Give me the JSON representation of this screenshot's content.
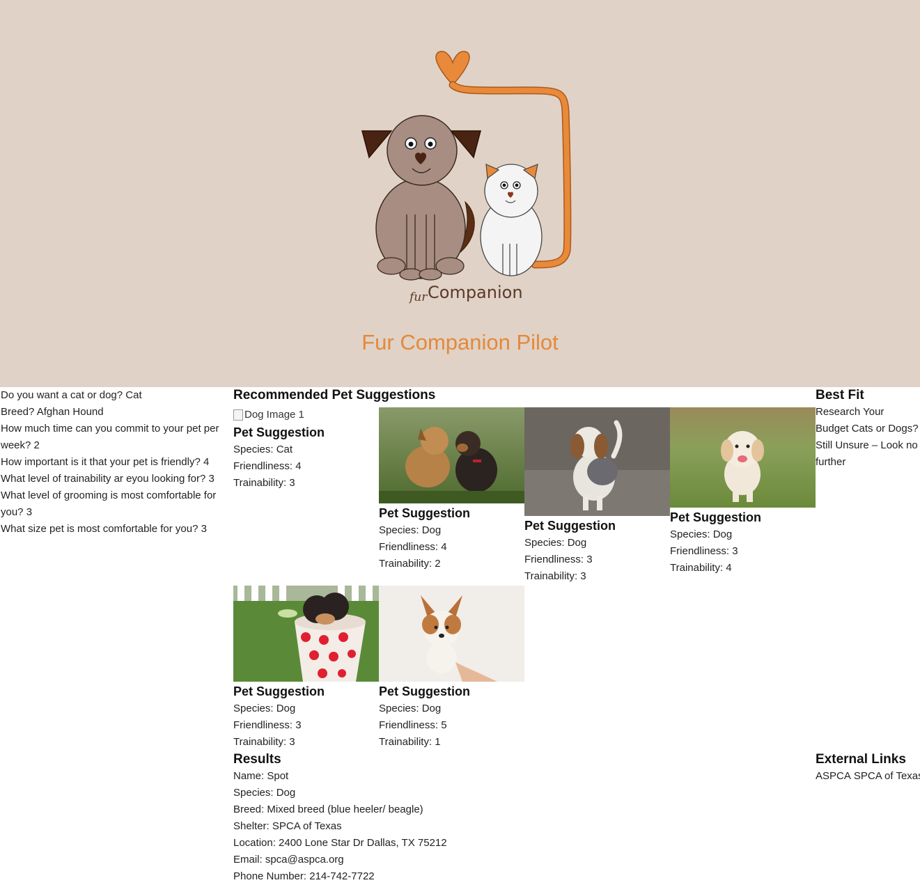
{
  "header": {
    "logo_text_small": "fur",
    "logo_text": "Companion",
    "title": "Fur Companion Pilot"
  },
  "questions": [
    {
      "text": "Do you want a cat or dog? Cat"
    },
    {
      "text": "Breed? Afghan Hound"
    },
    {
      "text": "How much time can you commit to your pet per week? 2"
    },
    {
      "text": "How important is it that your pet is friendly? 4"
    },
    {
      "text": "What level of trainability ar eyou looking for? 3"
    },
    {
      "text": "What level of grooming is most comfortable for you? 3"
    },
    {
      "text": "What size pet is most comfortable for you? 3"
    }
  ],
  "recommended": {
    "heading": "Recommended Pet Suggestions",
    "cards": [
      {
        "title": "Pet Suggestion",
        "alt": "Dog Image 1",
        "species": "Species: Cat",
        "friendliness": "Friendliness: 4",
        "trainability": "Trainability: 3"
      },
      {
        "title": "Pet Suggestion",
        "species": "Species: Dog",
        "friendliness": "Friendliness: 4",
        "trainability": "Trainability: 2"
      },
      {
        "title": "Pet Suggestion",
        "species": "Species: Dog",
        "friendliness": "Friendliness: 3",
        "trainability": "Trainability: 3"
      },
      {
        "title": "Pet Suggestion",
        "species": "Species: Dog",
        "friendliness": "Friendliness: 3",
        "trainability": "Trainability: 4"
      },
      {
        "title": "Pet Suggestion",
        "species": "Species: Dog",
        "friendliness": "Friendliness: 3",
        "trainability": "Trainability: 3"
      },
      {
        "title": "Pet Suggestion",
        "species": "Species: Dog",
        "friendliness": "Friendliness: 5",
        "trainability": "Trainability: 1"
      }
    ]
  },
  "best_fit": {
    "heading": "Best Fit",
    "text": "Research Your Budget Cats or Dogs? Still Unsure – Look no further"
  },
  "results": {
    "heading": "Results",
    "name": "Name: Spot",
    "species": "Species: Dog",
    "breed": "Breed: Mixed breed (blue heeler/ beagle)",
    "shelter": "Shelter: SPCA of Texas",
    "location": "Location: 2400 Lone Star Dr Dallas, TX 75212",
    "email": "Email: spca@aspca.org",
    "phone": "Phone Number: 214-742-7722"
  },
  "external_links": {
    "heading": "External Links",
    "links": [
      "ASPCA",
      "SPCA of Texas"
    ]
  },
  "colors": {
    "hero_bg": "#e0d2c6",
    "accent": "#e3893b"
  }
}
